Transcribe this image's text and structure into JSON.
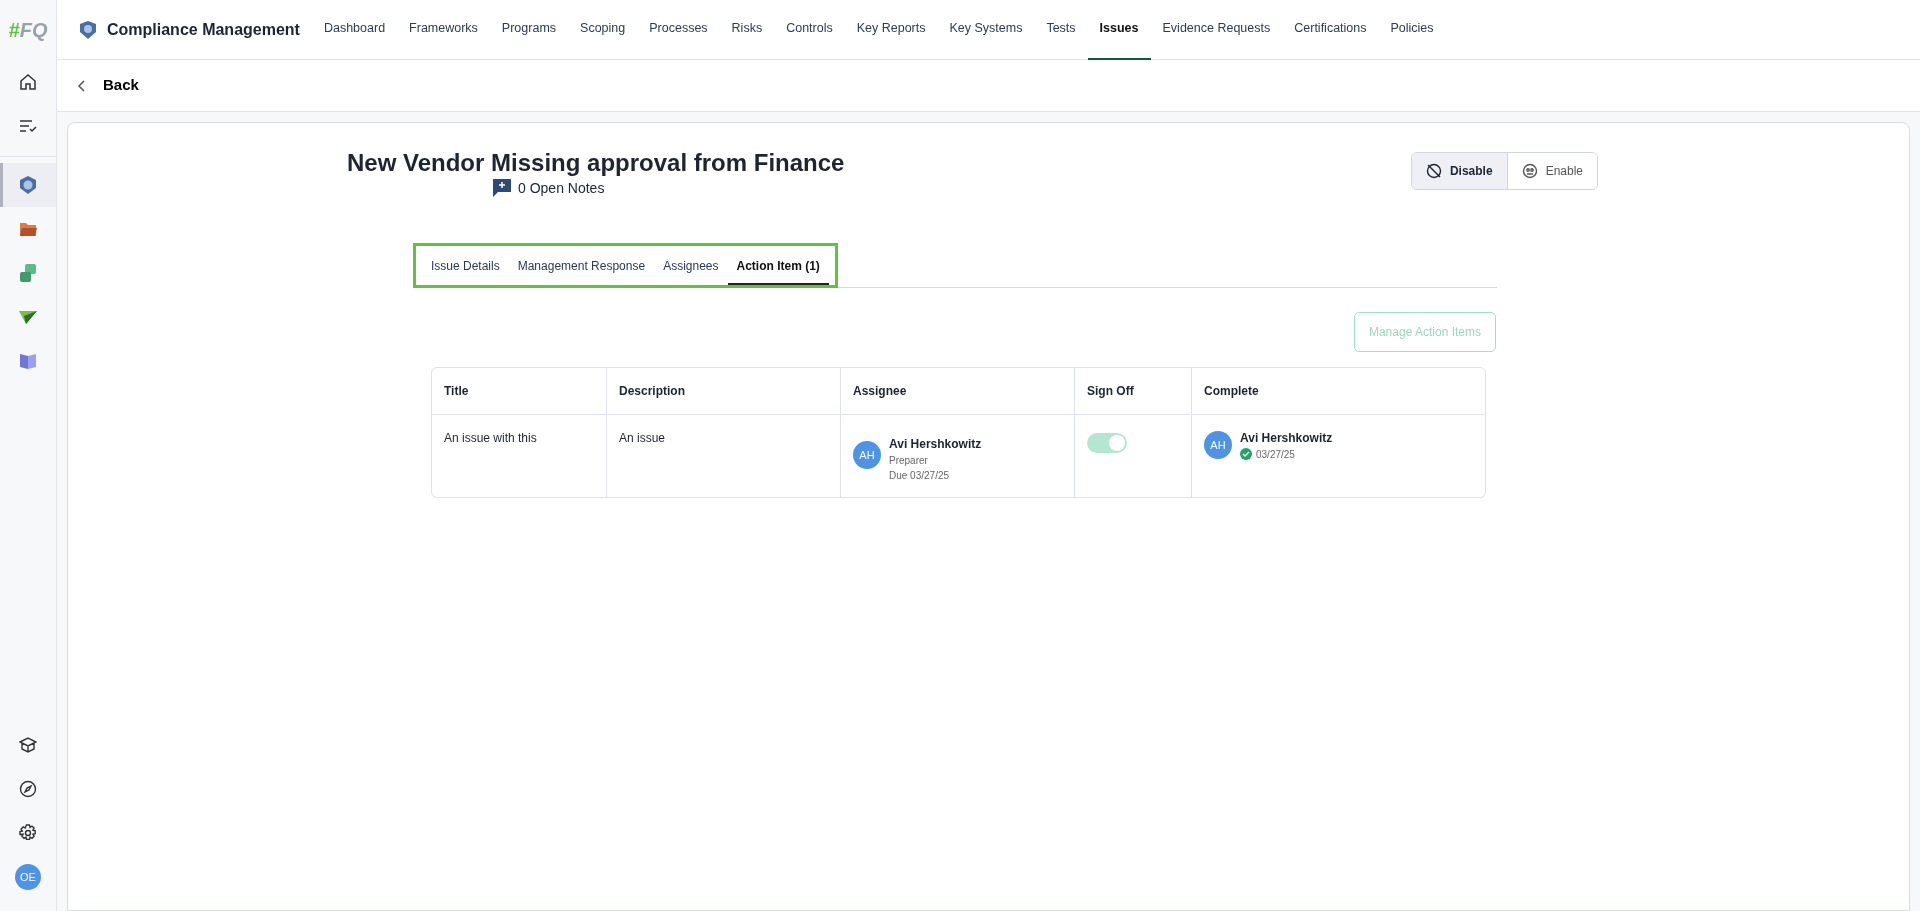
{
  "app": {
    "title": "Compliance Management"
  },
  "nav": [
    {
      "label": "Dashboard",
      "selected": false
    },
    {
      "label": "Frameworks",
      "selected": false
    },
    {
      "label": "Programs",
      "selected": false
    },
    {
      "label": "Scoping",
      "selected": false
    },
    {
      "label": "Processes",
      "selected": false
    },
    {
      "label": "Risks",
      "selected": false
    },
    {
      "label": "Controls",
      "selected": false
    },
    {
      "label": "Key Reports",
      "selected": false
    },
    {
      "label": "Key Systems",
      "selected": false
    },
    {
      "label": "Tests",
      "selected": false
    },
    {
      "label": "Issues",
      "selected": true
    },
    {
      "label": "Evidence Requests",
      "selected": false
    },
    {
      "label": "Certifications",
      "selected": false
    },
    {
      "label": "Policies",
      "selected": false
    }
  ],
  "sidebar": {
    "logo": {
      "mark": "#",
      "text": "FQ"
    },
    "apps": [
      {
        "selected": true
      },
      {
        "selected": false
      },
      {
        "selected": false
      },
      {
        "selected": false
      },
      {
        "selected": false
      }
    ],
    "user_initials": "OE"
  },
  "back": "Back",
  "issue": {
    "title": "New Vendor Missing approval from Finance",
    "notes": "0 Open Notes"
  },
  "mode_toggle": [
    {
      "label": "Disable",
      "selected": true
    },
    {
      "label": "Enable",
      "selected": false
    }
  ],
  "tabs": [
    {
      "label": "Issue Details",
      "selected": false
    },
    {
      "label": "Management Response",
      "selected": false
    },
    {
      "label": "Assignees",
      "selected": false
    },
    {
      "label": "Action Item (1)",
      "selected": true
    }
  ],
  "manage_button": {
    "label": "Manage Action Items",
    "disabled": true
  },
  "table": {
    "columns": [
      "Title",
      "Description",
      "Assignee",
      "Sign Off",
      "Complete"
    ],
    "rows": [
      {
        "title": "An issue with this",
        "description": "An issue",
        "assignee": {
          "initials": "AH",
          "name": "Avi Hershkowitz",
          "role": "Preparer",
          "due": "Due 03/27/25"
        },
        "sign_off": {
          "on": true
        },
        "complete": {
          "initials": "AH",
          "name": "Avi Hershkowitz",
          "date": "03/27/25",
          "done": true
        }
      }
    ]
  }
}
